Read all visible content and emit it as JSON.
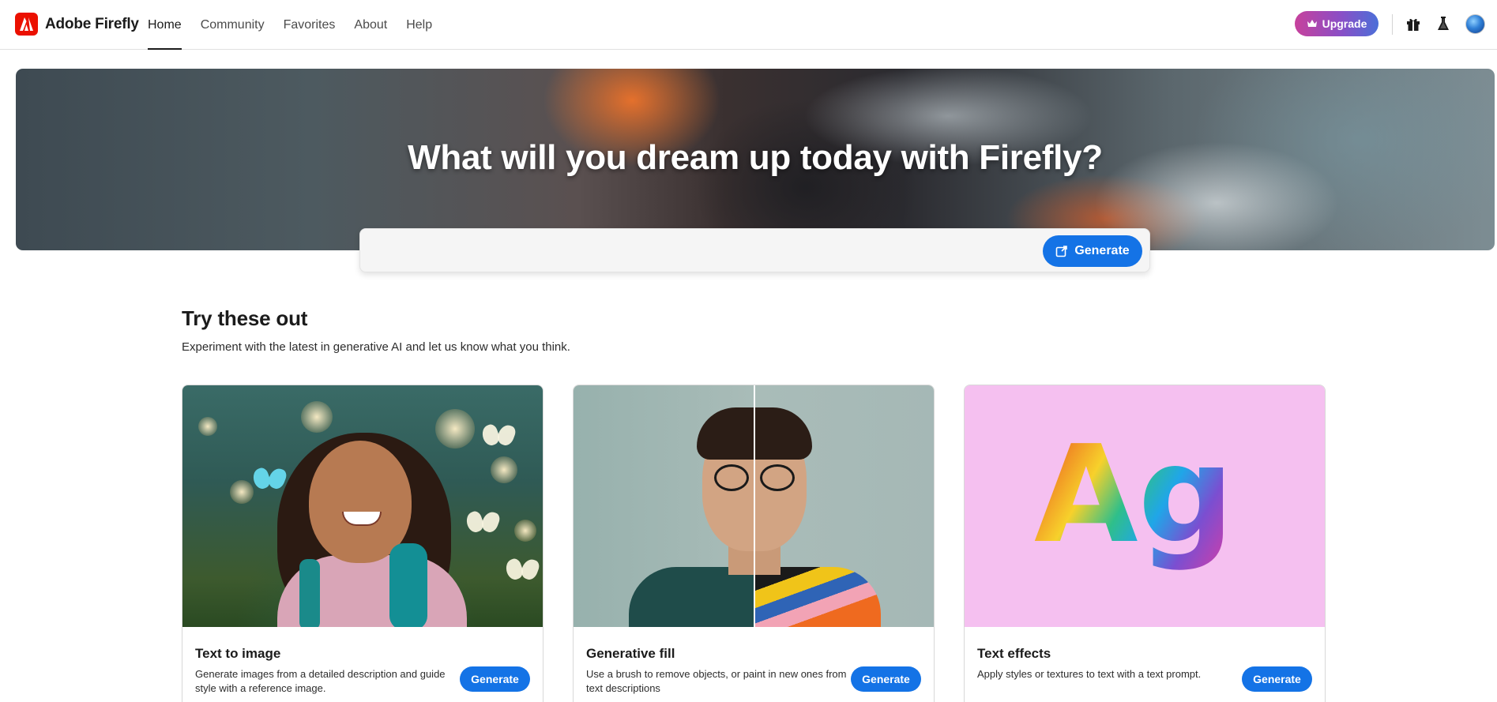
{
  "app": {
    "name": "Adobe Firefly"
  },
  "nav": {
    "items": [
      {
        "label": "Home",
        "active": true
      },
      {
        "label": "Community",
        "active": false
      },
      {
        "label": "Favorites",
        "active": false
      },
      {
        "label": "About",
        "active": false
      },
      {
        "label": "Help",
        "active": false
      }
    ]
  },
  "header_actions": {
    "upgrade_label": "Upgrade",
    "icons": [
      "gift-icon",
      "labs-flask-icon",
      "avatar"
    ]
  },
  "hero": {
    "title": "What will you dream up today with Firefly?",
    "prompt_value": "",
    "generate_label": "Generate"
  },
  "section": {
    "title": "Try these out",
    "subtitle": "Experiment with the latest in generative AI and let us know what you think."
  },
  "cards": [
    {
      "title": "Text to image",
      "description": "Generate images from a detailed description and guide style with a reference image.",
      "button": "Generate"
    },
    {
      "title": "Generative fill",
      "description": "Use a brush to remove objects, or paint in new ones from text descriptions",
      "button": "Generate"
    },
    {
      "title": "Text effects",
      "description": "Apply styles or textures to text with a text prompt.",
      "button": "Generate"
    }
  ],
  "card_art": {
    "text_effects_sample": "Ag"
  },
  "colors": {
    "accent": "#1473e6",
    "brand": "#eb1000"
  }
}
